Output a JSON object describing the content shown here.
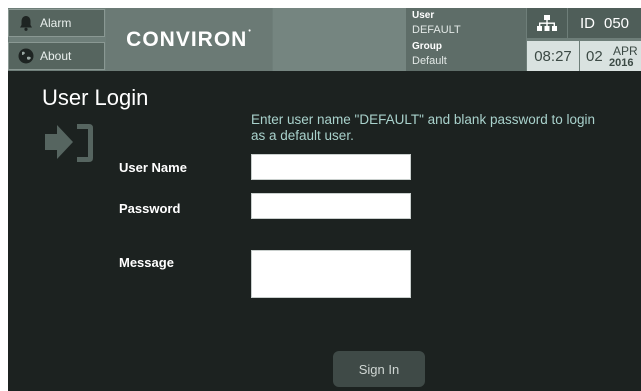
{
  "header": {
    "alarm_label": "Alarm",
    "about_label": "About",
    "logo_text": "CONVIRON",
    "user_label": "User",
    "user_value": "DEFAULT",
    "group_label": "Group",
    "group_value": "Default",
    "id_label": "ID",
    "id_value": "050",
    "time": "08:27",
    "date_day": "02",
    "date_month": "APR",
    "date_year": "2016",
    "icons": [
      "bell-icon",
      "globe-icon",
      "network-icon"
    ]
  },
  "login": {
    "title": "User Login",
    "hint": "Enter user name \"DEFAULT\" and blank password to login as a default user.",
    "username_label": "User Name",
    "username_value": "",
    "password_label": "Password",
    "password_value": "",
    "message_label": "Message",
    "message_value": "",
    "signin_label": "Sign In",
    "icon": "login-icon"
  },
  "colors": {
    "background": "#1c2220",
    "header": "#6e7e79",
    "hint_text": "#a9d2cc",
    "button": "#3f4a47"
  }
}
